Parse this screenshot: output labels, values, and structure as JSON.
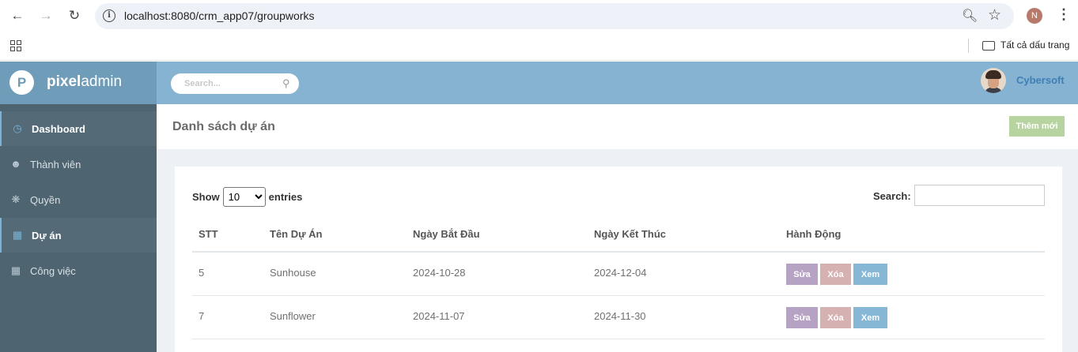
{
  "browser": {
    "url": "localhost:8080/crm_app07/groupworks",
    "profile_initial": "N",
    "bookmarks_all_label": "Tất cả dấu trang"
  },
  "brand": {
    "logo_letter": "P",
    "name_bold": "pixel",
    "name_light": "admin"
  },
  "topbar": {
    "search_placeholder": "Search...",
    "user_name": "Cybersoft"
  },
  "sidebar": {
    "items": [
      {
        "label": "Dashboard",
        "icon": "clock-icon",
        "active": true
      },
      {
        "label": "Thành viên",
        "icon": "user-icon",
        "active": false
      },
      {
        "label": "Quyền",
        "icon": "bug-icon",
        "active": false
      },
      {
        "label": "Dự án",
        "icon": "table-icon",
        "active": true
      },
      {
        "label": "Công việc",
        "icon": "table-icon",
        "active": false
      }
    ]
  },
  "page": {
    "title": "Danh sách dự án",
    "add_button": "Thêm mới"
  },
  "table_controls": {
    "show_label": "Show",
    "entries_label": "entries",
    "page_length": "10",
    "search_label": "Search:"
  },
  "table": {
    "headers": [
      "STT",
      "Tên Dự Án",
      "Ngày Bắt Đầu",
      "Ngày Kết Thúc",
      "Hành Động"
    ],
    "rows": [
      {
        "stt": "5",
        "name": "Sunhouse",
        "start": "2024-10-28",
        "end": "2024-12-04"
      },
      {
        "stt": "7",
        "name": "Sunflower",
        "start": "2024-11-07",
        "end": "2024-11-30"
      }
    ],
    "actions": {
      "edit": "Sửa",
      "delete": "Xóa",
      "view": "Xem"
    }
  },
  "colors": {
    "brand_bg": "#6f9cb8",
    "topbar_bg": "#86b3d1",
    "sidebar_bg": "#4e6470",
    "add_button": "#b7d4a0",
    "edit_button": "#b6a3c4",
    "delete_button": "#d5b1b2",
    "view_button": "#86b8d6"
  }
}
